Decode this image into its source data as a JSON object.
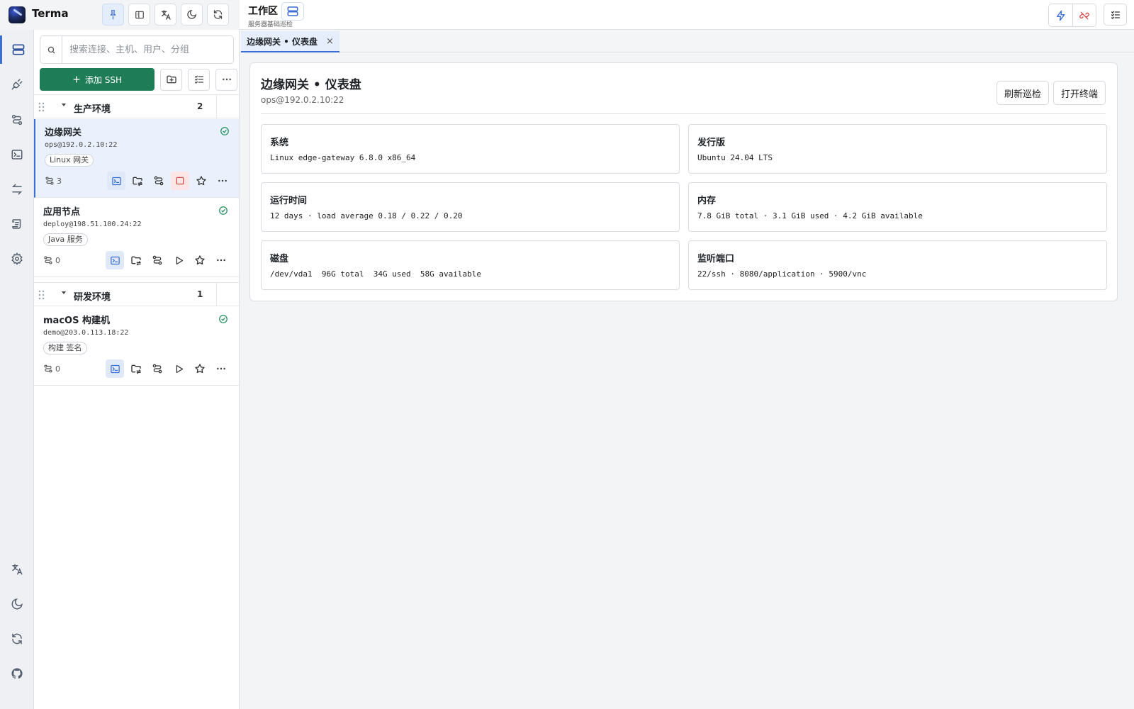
{
  "app": {
    "name": "Terma"
  },
  "workspace": {
    "title": "工作区",
    "subtitle": "服务器基础巡检"
  },
  "search": {
    "placeholder": "搜索连接、主机、用户、分组"
  },
  "toolbar": {
    "add_ssh_label": "添加 SSH"
  },
  "groups": [
    {
      "name": "生产环境",
      "count": "2",
      "hosts": [
        {
          "name": "边缘网关",
          "address": "ops@192.0.2.10:22",
          "tag": "Linux 网关",
          "connections": "3",
          "status": "online",
          "running": true
        },
        {
          "name": "应用节点",
          "address": "deploy@198.51.100.24:22",
          "tag": "Java 服务",
          "connections": "0",
          "status": "online",
          "running": false
        }
      ]
    },
    {
      "name": "研发环境",
      "count": "1",
      "hosts": [
        {
          "name": "macOS 构建机",
          "address": "demo@203.0.113.18:22",
          "tag": "构建 签名",
          "connections": "0",
          "status": "online",
          "running": false
        }
      ]
    }
  ],
  "tabs": [
    {
      "label": "边缘网关 • 仪表盘",
      "close": "×"
    }
  ],
  "dashboard": {
    "title": "边缘网关 • 仪表盘",
    "subtitle": "ops@192.0.2.10:22",
    "refresh_label": "刷新巡检",
    "open_terminal_label": "打开终端",
    "cards": [
      {
        "label": "系统",
        "value": "Linux edge-gateway 6.8.0 x86_64"
      },
      {
        "label": "发行版",
        "value": "Ubuntu 24.04 LTS"
      },
      {
        "label": "运行时间",
        "value": "12 days · load average 0.18 / 0.22 / 0.20"
      },
      {
        "label": "内存",
        "value": "7.8 GiB total · 3.1 GiB used · 4.2 GiB available"
      },
      {
        "label": "磁盘",
        "value": "/dev/vda1  96G total  34G used  58G available"
      },
      {
        "label": "监听端口",
        "value": "22/ssh · 8080/application · 5900/vnc"
      }
    ]
  },
  "colors": {
    "accent": "#3b6fd4",
    "primary_button": "#1e7c57",
    "status_online": "#23925e",
    "danger": "#d94a4a"
  },
  "icons": {
    "activity": [
      "server-list-icon",
      "plug-icon",
      "route-icon",
      "terminal-icon",
      "transfer-icon",
      "script-icon",
      "gear-icon"
    ],
    "activity_bottom": [
      "translate-icon",
      "moon-icon",
      "sync-icon",
      "github-icon"
    ]
  }
}
